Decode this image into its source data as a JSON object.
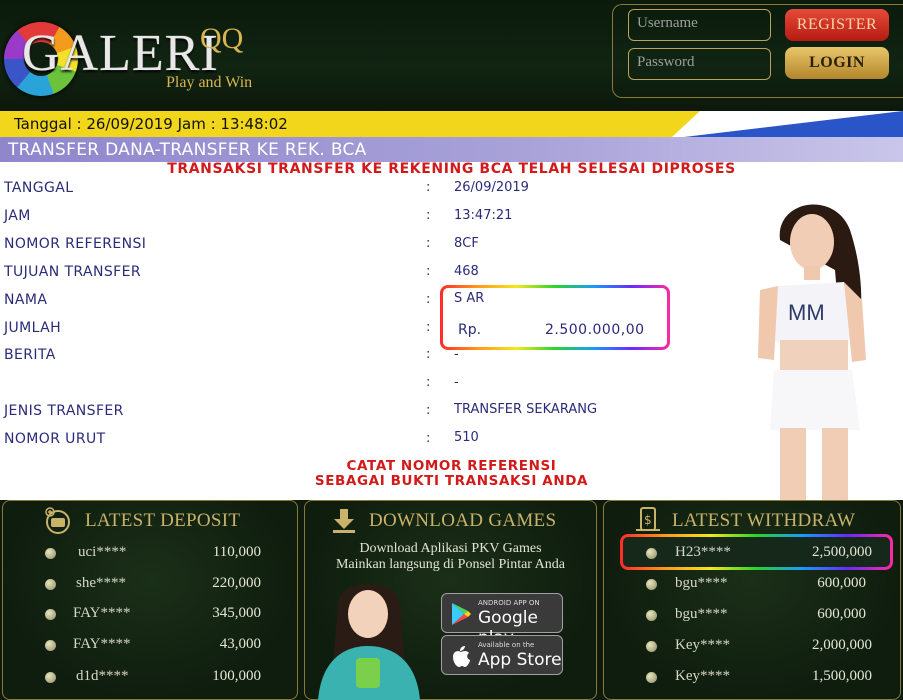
{
  "header": {
    "logo_text": "GALERI",
    "logo_qq": "QQ",
    "tagline": "Play and Win",
    "username_placeholder": "Username",
    "password_placeholder": "Password",
    "register_label": "REGISTER",
    "login_label": "LOGIN"
  },
  "receipt": {
    "date_line": "Tanggal : 26/09/2019 Jam : 13:48:02",
    "title": "TRANSFER DANA-TRANSFER KE REK. BCA",
    "status": "TRANSAKSI TRANSFER KE REKENING BCA TELAH SELESAI DIPROSES",
    "rows": [
      {
        "label": "TANGGAL",
        "value": "26/09/2019"
      },
      {
        "label": "JAM",
        "value": "13:47:21"
      },
      {
        "label": "NOMOR REFERENSI",
        "value": "8CF"
      },
      {
        "label": "TUJUAN TRANSFER",
        "value": "468"
      },
      {
        "label": "NAMA",
        "value": "S AR"
      },
      {
        "label": "JUMLAH",
        "value": ""
      },
      {
        "label": "BERITA",
        "value": "-"
      },
      {
        "label": "",
        "value": "-"
      },
      {
        "label": "JENIS TRANSFER",
        "value": "TRANSFER SEKARANG"
      },
      {
        "label": "NOMOR URUT",
        "value": "510"
      }
    ],
    "colon": ":",
    "amount_currency": "Rp.",
    "amount_value": "2.500.000,00",
    "note_line1": "CATAT NOMOR REFERENSI",
    "note_line2": "SEBAGAI BUKTI TRANSAKSI ANDA"
  },
  "deposit": {
    "title": "LATEST DEPOSIT",
    "entries": [
      {
        "name": "uci****",
        "amount": "110,000"
      },
      {
        "name": "she****",
        "amount": "220,000"
      },
      {
        "name": "FAY****",
        "amount": "345,000"
      },
      {
        "name": "FAY****",
        "amount": "43,000"
      },
      {
        "name": "d1d****",
        "amount": "100,000"
      }
    ]
  },
  "download": {
    "title": "DOWNLOAD GAMES",
    "line1": "Download Aplikasi PKV Games",
    "line2": "Mainkan langsung di Ponsel Pintar Anda",
    "google_small": "ANDROID APP ON",
    "google_big": "Google play",
    "apple_small": "Available on the",
    "apple_big": "App Store"
  },
  "withdraw": {
    "title": "LATEST WITHDRAW",
    "entries": [
      {
        "name": "H23****",
        "amount": "2,500,000"
      },
      {
        "name": "bgu****",
        "amount": "600,000"
      },
      {
        "name": "bgu****",
        "amount": "600,000"
      },
      {
        "name": "Key****",
        "amount": "2,000,000"
      },
      {
        "name": "Key****",
        "amount": "1,500,000"
      }
    ]
  },
  "colors": {
    "accent_gold": "#c9b26a",
    "register_red": "#c8281a",
    "title_purple": "#8f86cc",
    "status_red": "#d21a1a"
  }
}
